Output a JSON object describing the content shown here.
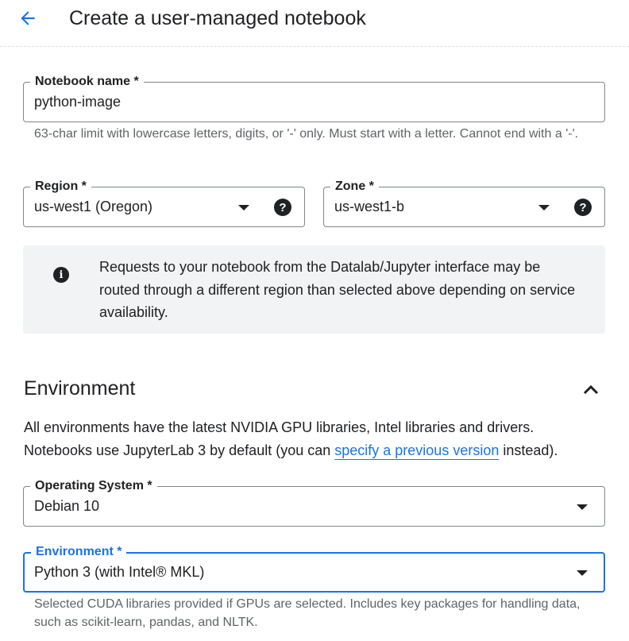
{
  "header": {
    "title": "Create a user-managed notebook"
  },
  "notebook_name": {
    "label": "Notebook name *",
    "value": "python-image",
    "hint": "63-char limit with lowercase letters, digits, or '-' only. Must start with a letter. Cannot end with a '-'."
  },
  "region": {
    "label": "Region *",
    "value": "us-west1 (Oregon)"
  },
  "zone": {
    "label": "Zone *",
    "value": "us-west1-b"
  },
  "info": {
    "text": "Requests to your notebook from the Datalab/Jupyter interface may be routed through a different region than selected above depending on service availability."
  },
  "environment_section": {
    "title": "Environment",
    "desc_line1": "All environments have the latest NVIDIA GPU libraries, Intel libraries and drivers.",
    "desc_line2_prefix": "Notebooks use JupyterLab 3 by default (you can ",
    "desc_link": "specify a previous version",
    "desc_line2_suffix": " instead)."
  },
  "operating_system": {
    "label": "Operating System *",
    "value": "Debian 10"
  },
  "environment": {
    "label": "Environment *",
    "value": "Python 3 (with Intel® MKL)",
    "hint": "Selected CUDA libraries provided if GPUs are selected. Includes key packages for handling data, such as scikit-learn, pandas, and NLTK."
  },
  "colors": {
    "accent": "#1a73e8",
    "text": "#202124",
    "hint": "#5f6368",
    "info_bg": "#f1f3f4",
    "border": "#80868b"
  },
  "icons": {
    "back": "arrow-back-icon",
    "help": "help-icon",
    "info": "info-icon",
    "collapse": "chevron-up-icon",
    "dropdown": "dropdown-arrow-icon"
  }
}
